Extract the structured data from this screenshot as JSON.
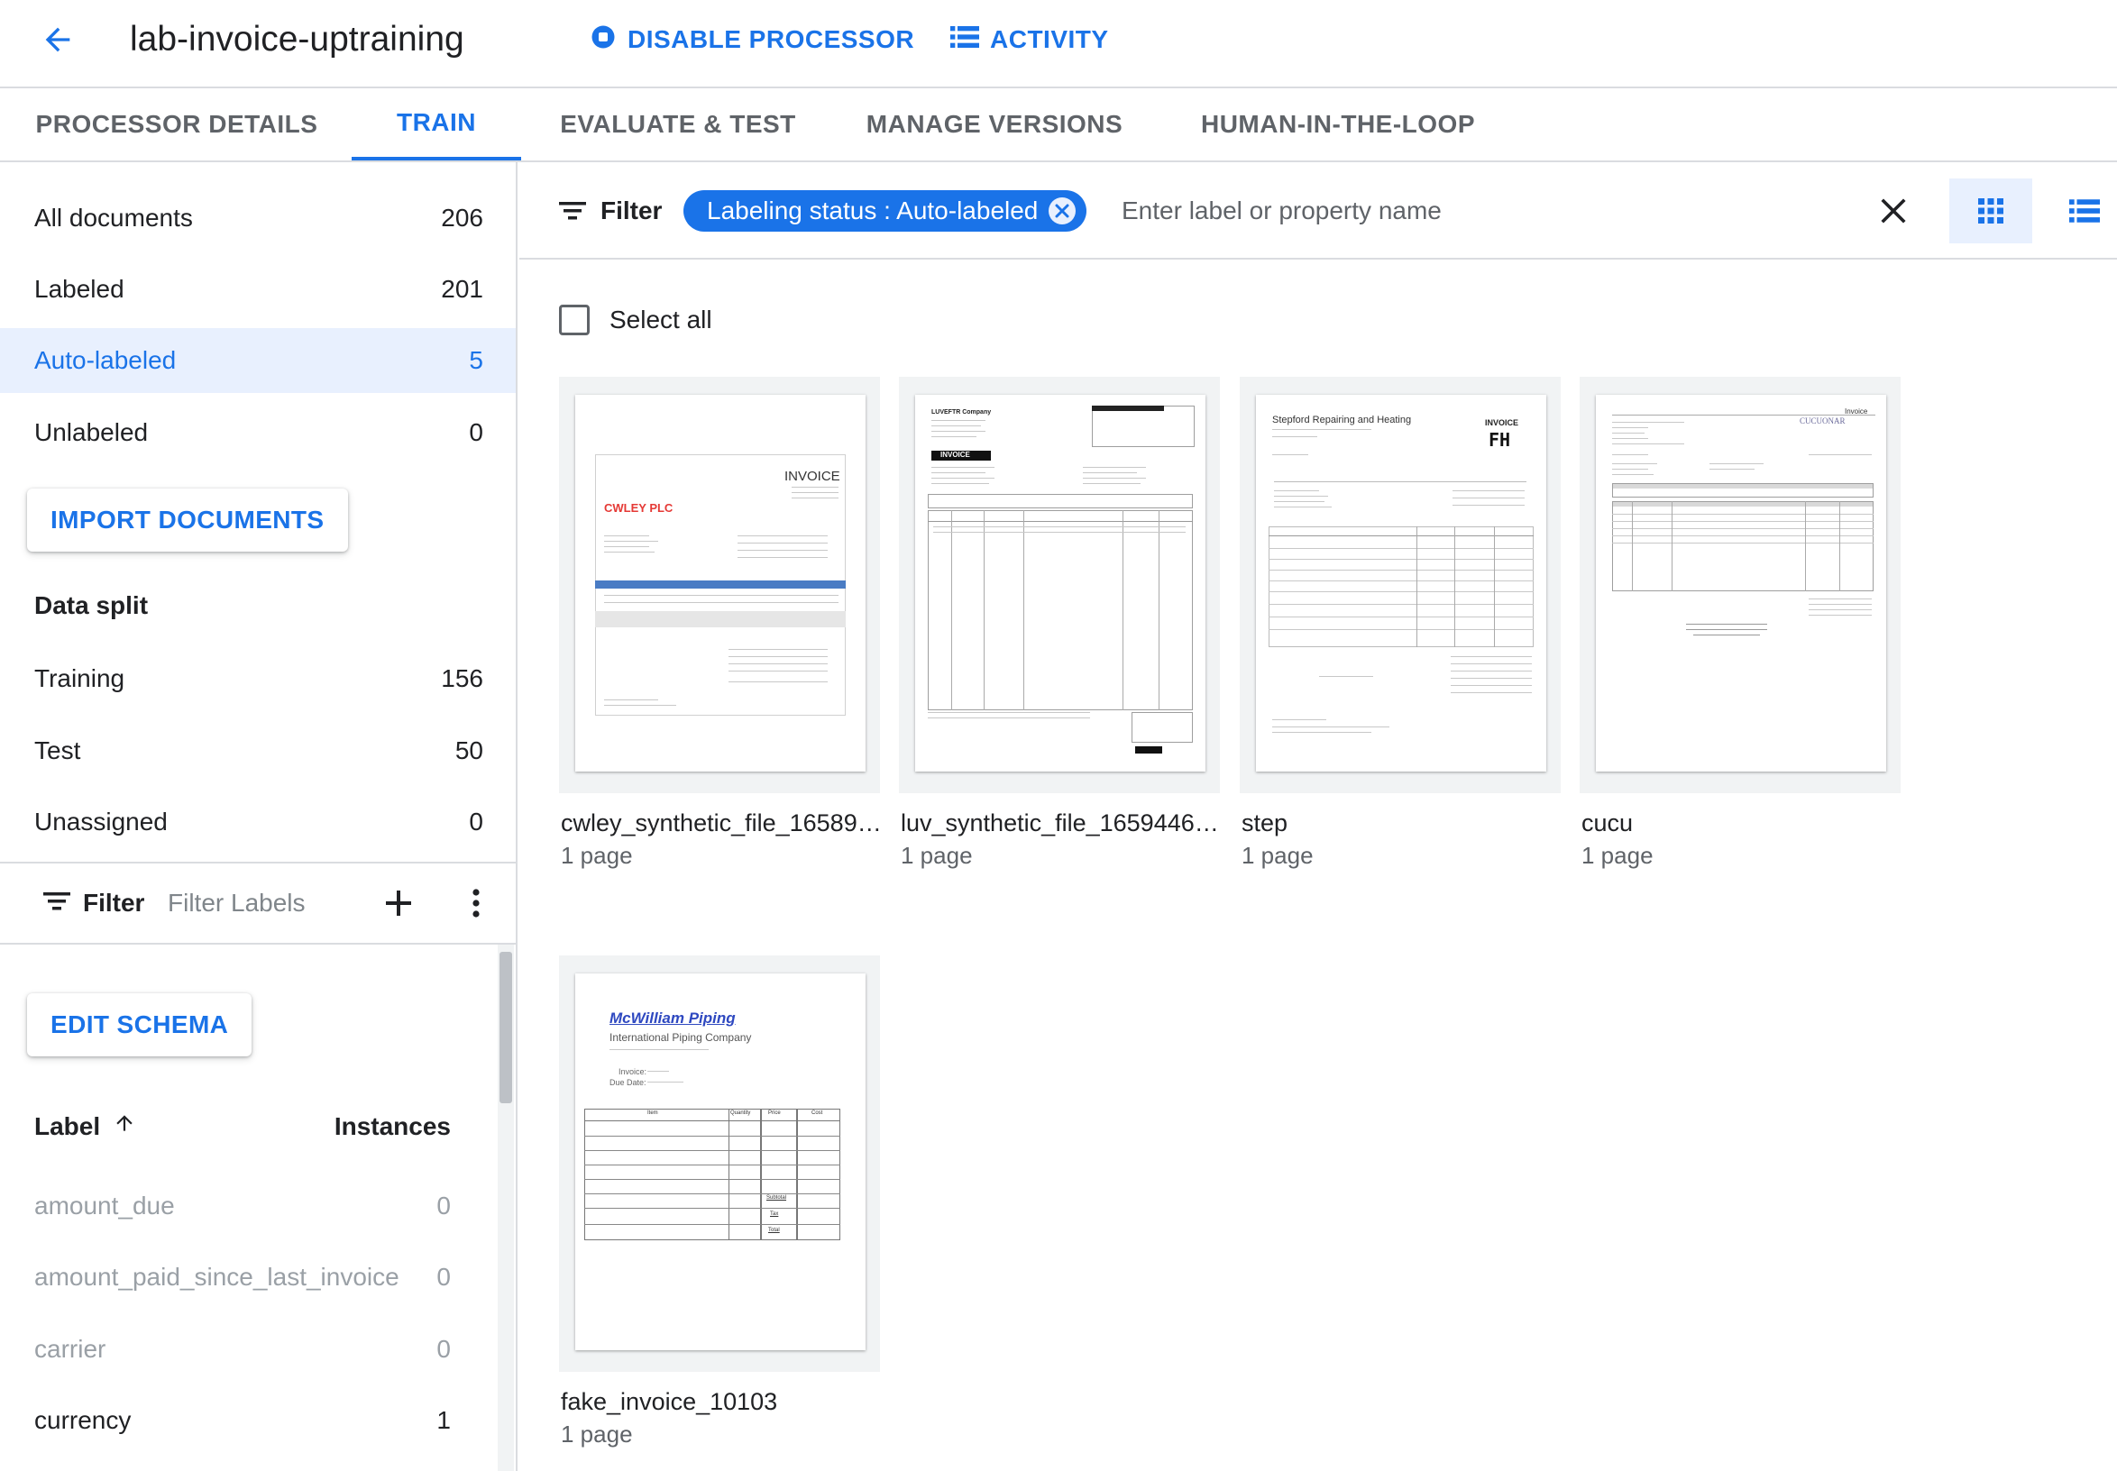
{
  "header": {
    "title": "lab-invoice-uptraining",
    "disable_processor": "DISABLE PROCESSOR",
    "activity": "ACTIVITY"
  },
  "tabs": [
    {
      "label": "PROCESSOR DETAILS",
      "active": false
    },
    {
      "label": "TRAIN",
      "active": true
    },
    {
      "label": "EVALUATE & TEST",
      "active": false
    },
    {
      "label": "MANAGE VERSIONS",
      "active": false
    },
    {
      "label": "HUMAN-IN-THE-LOOP",
      "active": false
    }
  ],
  "sidebar": {
    "nav": [
      {
        "label": "All documents",
        "count": "206"
      },
      {
        "label": "Labeled",
        "count": "201"
      },
      {
        "label": "Auto-labeled",
        "count": "5"
      },
      {
        "label": "Unlabeled",
        "count": "0"
      }
    ],
    "import_button": "IMPORT DOCUMENTS",
    "data_split_title": "Data split",
    "data_split": [
      {
        "label": "Training",
        "count": "156"
      },
      {
        "label": "Test",
        "count": "50"
      },
      {
        "label": "Unassigned",
        "count": "0"
      }
    ],
    "label_filter": {
      "label": "Filter",
      "placeholder": "Filter Labels"
    },
    "edit_schema": "EDIT SCHEMA",
    "label_column": "Label",
    "instances_column": "Instances",
    "labels": [
      {
        "name": "amount_due",
        "instances": "0"
      },
      {
        "name": "amount_paid_since_last_invoice",
        "instances": "0"
      },
      {
        "name": "carrier",
        "instances": "0"
      },
      {
        "name": "currency",
        "instances": "1"
      }
    ]
  },
  "main": {
    "filter_label": "Filter",
    "chip": "Labeling status : Auto-labeled",
    "filter_placeholder": "Enter label or property name",
    "select_all": "Select all",
    "documents": [
      {
        "name": "cwley_synthetic_file_165893...",
        "pages": "1 page"
      },
      {
        "name": "luv_synthetic_file_16594466...",
        "pages": "1 page"
      },
      {
        "name": "step",
        "pages": "1 page"
      },
      {
        "name": "cucu",
        "pages": "1 page"
      },
      {
        "name": "fake_invoice_10103",
        "pages": "1 page"
      }
    ],
    "thumb_text": {
      "cwley_invoice": "INVOICE",
      "cwley_company": "CWLEY PLC",
      "luv_company": "LUVEFTR Company",
      "luv_invoice": "INVOICE",
      "step_company": "Stepford Repairing and Heating",
      "step_invoice": "INVOICE",
      "step_logo": "FH",
      "cucu_invoice": "Invoice",
      "cucu_company": "CUCUONAR",
      "mcw_company": "McWilliam Piping",
      "mcw_subtitle": "International Piping Company",
      "mcw_invoice": "Invoice:",
      "mcw_due": "Due Date:",
      "mcw_col_item": "Item",
      "mcw_col_qty": "Quantity",
      "mcw_col_price": "Price",
      "mcw_col_cost": "Cost",
      "mcw_subtotal": "Subtotal",
      "mcw_tax": "Tax",
      "mcw_total": "Total"
    }
  },
  "colors": {
    "accent": "#1a73e8",
    "active_bg": "#e8f0fe",
    "divider": "#dadce0",
    "cwley_red": "#e53935",
    "cwley_blue": "#4a7cc4",
    "mcw_blue": "#2e48c0"
  }
}
